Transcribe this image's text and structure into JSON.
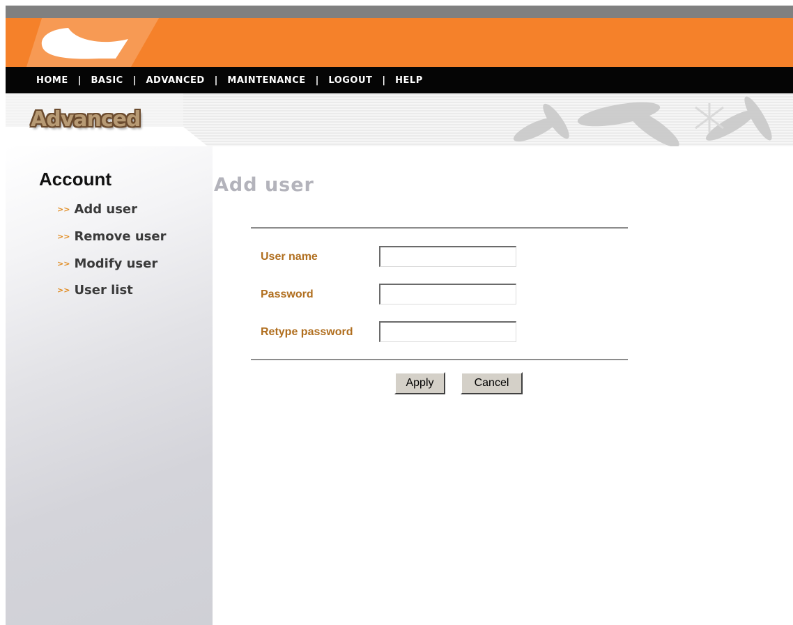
{
  "nav": {
    "items": [
      "HOME",
      "BASIC",
      "ADVANCED",
      "MAINTENANCE",
      "LOGOUT",
      "HELP"
    ],
    "separator": "|"
  },
  "header": {
    "section_title": "Advanced"
  },
  "sidebar": {
    "title": "Account",
    "arrow": ">>",
    "links": [
      "Add user",
      "Remove user",
      "Modify user",
      "User list"
    ]
  },
  "form": {
    "title": "Add user",
    "fields": {
      "username": {
        "label": "User name",
        "value": ""
      },
      "password": {
        "label": "Password",
        "value": ""
      },
      "retype": {
        "label": "Retype password",
        "value": ""
      }
    },
    "apply_label": "Apply",
    "cancel_label": "Cancel"
  },
  "colors": {
    "banner": "#f5812a",
    "navbar": "#050505",
    "label": "#b06e1e",
    "title_gray": "#b3b3bb",
    "arrow": "#e08a1e"
  }
}
